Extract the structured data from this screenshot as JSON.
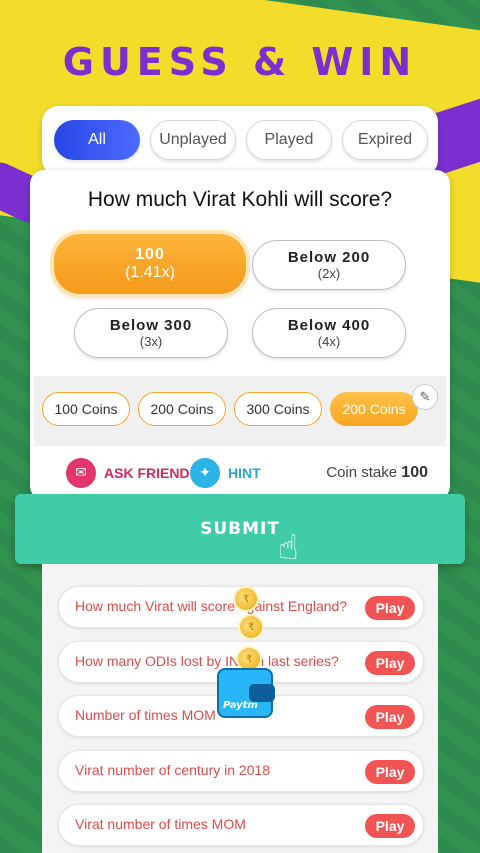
{
  "title": "GUESS & WIN",
  "tabs": [
    {
      "label": "All",
      "active": true
    },
    {
      "label": "Unplayed",
      "active": false
    },
    {
      "label": "Played",
      "active": false
    },
    {
      "label": "Expired",
      "active": false
    }
  ],
  "question": "How much Virat Kohli will score?",
  "options": [
    {
      "label": "100",
      "multiplier": "(1.41x)",
      "selected": true
    },
    {
      "label": "Below 200",
      "multiplier": "(2x)",
      "selected": false
    },
    {
      "label": "Below 300",
      "multiplier": "(3x)",
      "selected": false
    },
    {
      "label": "Below 400",
      "multiplier": "(4x)",
      "selected": false
    }
  ],
  "coins": [
    {
      "label": "100 Coins",
      "selected": false
    },
    {
      "label": "200 Coins",
      "selected": false
    },
    {
      "label": "300 Coins",
      "selected": false
    },
    {
      "label": "200 Coins",
      "selected": true
    }
  ],
  "actions": {
    "ask_friend": "ASK FRIEND",
    "hint": "HINT",
    "coin_stake_label": "Coin stake",
    "coin_stake_value": "100"
  },
  "submit_label": "SUBMIT",
  "list": [
    {
      "text": "How much Virat will score against England?",
      "action": "Play"
    },
    {
      "text": "How many ODIs lost by IND in last series?",
      "action": "Play"
    },
    {
      "text": "Number of times MOM",
      "action": "Play"
    },
    {
      "text": "Virat number of century in 2018",
      "action": "Play"
    },
    {
      "text": "Virat number of times MOM",
      "action": "Play"
    }
  ],
  "wallet_brand": "Paytm",
  "colors": {
    "accent_purple": "#7d2ed1",
    "tab_active": "#2846e6",
    "option_selected": "#f59a1a",
    "submit": "#3fcca6",
    "play": "#f25454"
  }
}
